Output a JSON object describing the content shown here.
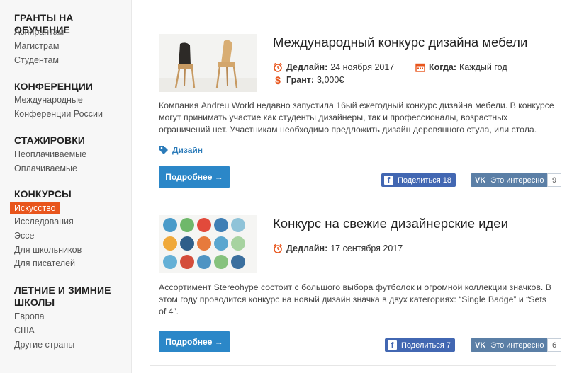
{
  "sidebar": {
    "sections": [
      {
        "title": "ГРАНТЫ НА ОБУЧЕНИЕ",
        "links": [
          "Аспирантам",
          "Магистрам",
          "Студентам"
        ]
      },
      {
        "title": "КОНФЕРЕНЦИИ",
        "links": [
          "Международные",
          "Конференции России"
        ]
      },
      {
        "title": "СТАЖИРОВКИ",
        "links": [
          "Неоплачиваемые",
          "Оплачиваемые"
        ]
      },
      {
        "title": "КОНКУРСЫ",
        "links": [
          "Искусство",
          "Исследования",
          "Эссе",
          "Для школьников",
          "Для писателей"
        ],
        "active": "Искусство"
      },
      {
        "title_line1": "ЛЕТНИЕ И ЗИМНИЕ",
        "title_line2": "ШКОЛЫ",
        "links": [
          "Европа",
          "США",
          "Другие страны"
        ]
      }
    ]
  },
  "cards": [
    {
      "title": "Международный конкурс дизайна мебели",
      "deadline_label": "Дедлайн:",
      "deadline_value": "24 ноября 2017",
      "when_label": "Когда:",
      "when_value": "Каждый год",
      "grant_label": "Грант:",
      "grant_value": "3,000€",
      "description": "Компания Andreu World недавно запустила 16ый ежегодный конкурс дизайна мебели. В конкурсе могут принимать участие как студенты дизайнеры, так и профессионалы, возрастных ограничений нет. Участникам необходимо предложить дизайн деревянного стула, или стола.",
      "tag": "Дизайн",
      "more_label": "Подробнее →",
      "fb_label": "Поделиться 18",
      "vk_logo": "VK",
      "vk_label": "Это интересно",
      "vk_count": "9"
    },
    {
      "title": "Конкурс на свежие дизайнерские идеи",
      "deadline_label": "Дедлайн:",
      "deadline_value": "17 сентября 2017",
      "description": "Ассортимент Stereohype состоит с большого выбора футболок и огромной коллекции значков. В этом году проводится конкурс на новый дизайн значка в двух категориях: “Single Badge” и “Sets of 4”.",
      "more_label": "Подробнее →",
      "fb_label": "Поделиться 7",
      "vk_logo": "VK",
      "vk_label": "Это интересно",
      "vk_count": "6"
    }
  ],
  "colors": {
    "accent": "#e8551c",
    "button": "#2b87c8",
    "facebook": "#4267b2",
    "vk": "#5b7fa6",
    "icon": "#e8551c"
  }
}
